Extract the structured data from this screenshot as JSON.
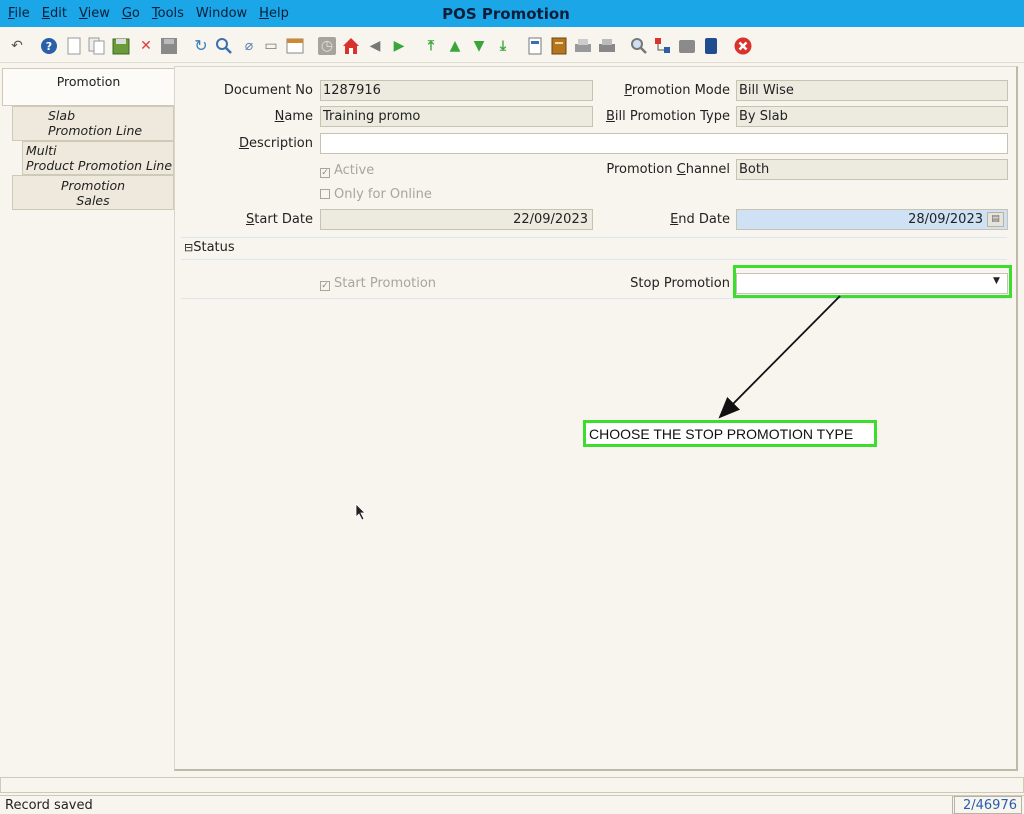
{
  "window": {
    "title": "POS Promotion",
    "menu": [
      {
        "label": "File",
        "ul": "F",
        "rest": "ile"
      },
      {
        "label": "Edit",
        "ul": "E",
        "rest": "dit"
      },
      {
        "label": "View",
        "ul": "V",
        "rest": "iew"
      },
      {
        "label": "Go",
        "ul": "G",
        "rest": "o"
      },
      {
        "label": "Tools",
        "ul": "T",
        "rest": "ools"
      },
      {
        "label": "Window",
        "ul": "",
        "rest": "Window"
      },
      {
        "label": "Help",
        "ul": "H",
        "rest": "elp"
      }
    ]
  },
  "tabs": {
    "promotion": "Promotion",
    "slab_line1": "Slab",
    "slab_line2": "Promotion Line",
    "multi_line1": "Multi",
    "multi_line2": "Product Promotion Line",
    "sales_line1": "Promotion",
    "sales_line2": "Sales"
  },
  "form": {
    "document_no_label": "Document No",
    "document_no": "1287916",
    "name_label": "Name",
    "name": "Training promo",
    "description_label": "Description",
    "description": "",
    "active_label": "Active",
    "active_checked": true,
    "online_label": "Only for Online",
    "online_checked": false,
    "start_date_label": "Start Date",
    "start_date": "22/09/2023",
    "promotion_mode_label": "Promotion Mode",
    "promotion_mode": "Bill Wise",
    "bill_promotion_type_label": "Bill Promotion Type",
    "bill_promotion_type": "By Slab",
    "promotion_channel_label": "Promotion Channel",
    "promotion_channel": "Both",
    "end_date_label": "End Date",
    "end_date": "28/09/2023"
  },
  "status_section": {
    "title": "Status",
    "toggle_symbol": "⊟",
    "start_promotion_label": "Start Promotion",
    "start_promotion_checked": true,
    "stop_promotion_label": "Stop Promotion",
    "stop_promotion_value": ""
  },
  "annotation": {
    "callout_text": "CHOOSE THE STOP PROMOTION TYPE",
    "highlight_color": "#3ddc2f"
  },
  "statusbar": {
    "message": "Record saved",
    "record_count": "2/46976"
  },
  "toolbar_icons": [
    "undo-icon",
    "help-icon",
    "new-icon",
    "copy-icon",
    "save-new-icon",
    "delete-icon",
    "save-icon",
    "refresh-icon",
    "find-icon",
    "attachment-icon",
    "chat-icon",
    "grid-toggle-icon",
    "history-icon",
    "home-icon",
    "back-icon",
    "forward-icon",
    "first-record-icon",
    "previous-record-icon",
    "next-record-icon",
    "last-record-icon",
    "report-icon",
    "archive-icon",
    "print-preview-icon",
    "print-icon",
    "zoom-across-icon",
    "workflow-icon",
    "product-info-icon",
    "lock-icon",
    "close-window-icon"
  ]
}
